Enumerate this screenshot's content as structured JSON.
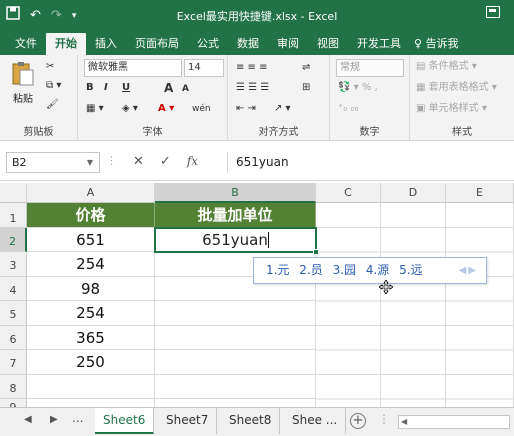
{
  "titlebar": {
    "title": "Excel最实用快捷键.xlsx - Excel",
    "qat_icons": [
      "save-icon",
      "undo-icon",
      "redo-icon",
      "customize-icon"
    ]
  },
  "tabs": [
    "文件",
    "开始",
    "插入",
    "页面布局",
    "公式",
    "数据",
    "审阅",
    "视图",
    "开发工具",
    "告诉我"
  ],
  "active_tab": "开始",
  "ribbon": {
    "clipboard": {
      "paste": "粘贴",
      "label": "剪贴板"
    },
    "font": {
      "name": "微软雅黑",
      "size": "14",
      "label": "字体",
      "bold": "B",
      "italic": "I",
      "underline": "U",
      "grow": "A",
      "shrink": "A",
      "phonetic": "wén"
    },
    "alignment": {
      "label": "对齐方式"
    },
    "number": {
      "format": "常规",
      "label": "数字"
    },
    "styles": {
      "conditional": "条件格式",
      "table": "套用表格格式",
      "cell": "单元格样式",
      "label": "样式"
    }
  },
  "formula_bar": {
    "name_box": "B2",
    "value": "651yuan",
    "fx": "fx"
  },
  "columns": [
    "A",
    "B",
    "C",
    "D",
    "E"
  ],
  "rows": [
    "1",
    "2",
    "3",
    "4",
    "5",
    "6",
    "7",
    "8",
    "9"
  ],
  "header_row": {
    "a": "价格",
    "b": "批量加单位"
  },
  "cells_a": [
    "651",
    "254",
    "98",
    "254",
    "365",
    "250"
  ],
  "active_cell_text": "651yuan",
  "ime": {
    "candidates": [
      "1.元",
      "2.员",
      "3.园",
      "4.源",
      "5.远"
    ]
  },
  "sheets": [
    "Sheet6",
    "Sheet7",
    "Sheet8",
    "Shee ..."
  ],
  "active_sheet": "Sheet6",
  "colors": {
    "accent": "#217346",
    "header_fill": "#548235"
  }
}
